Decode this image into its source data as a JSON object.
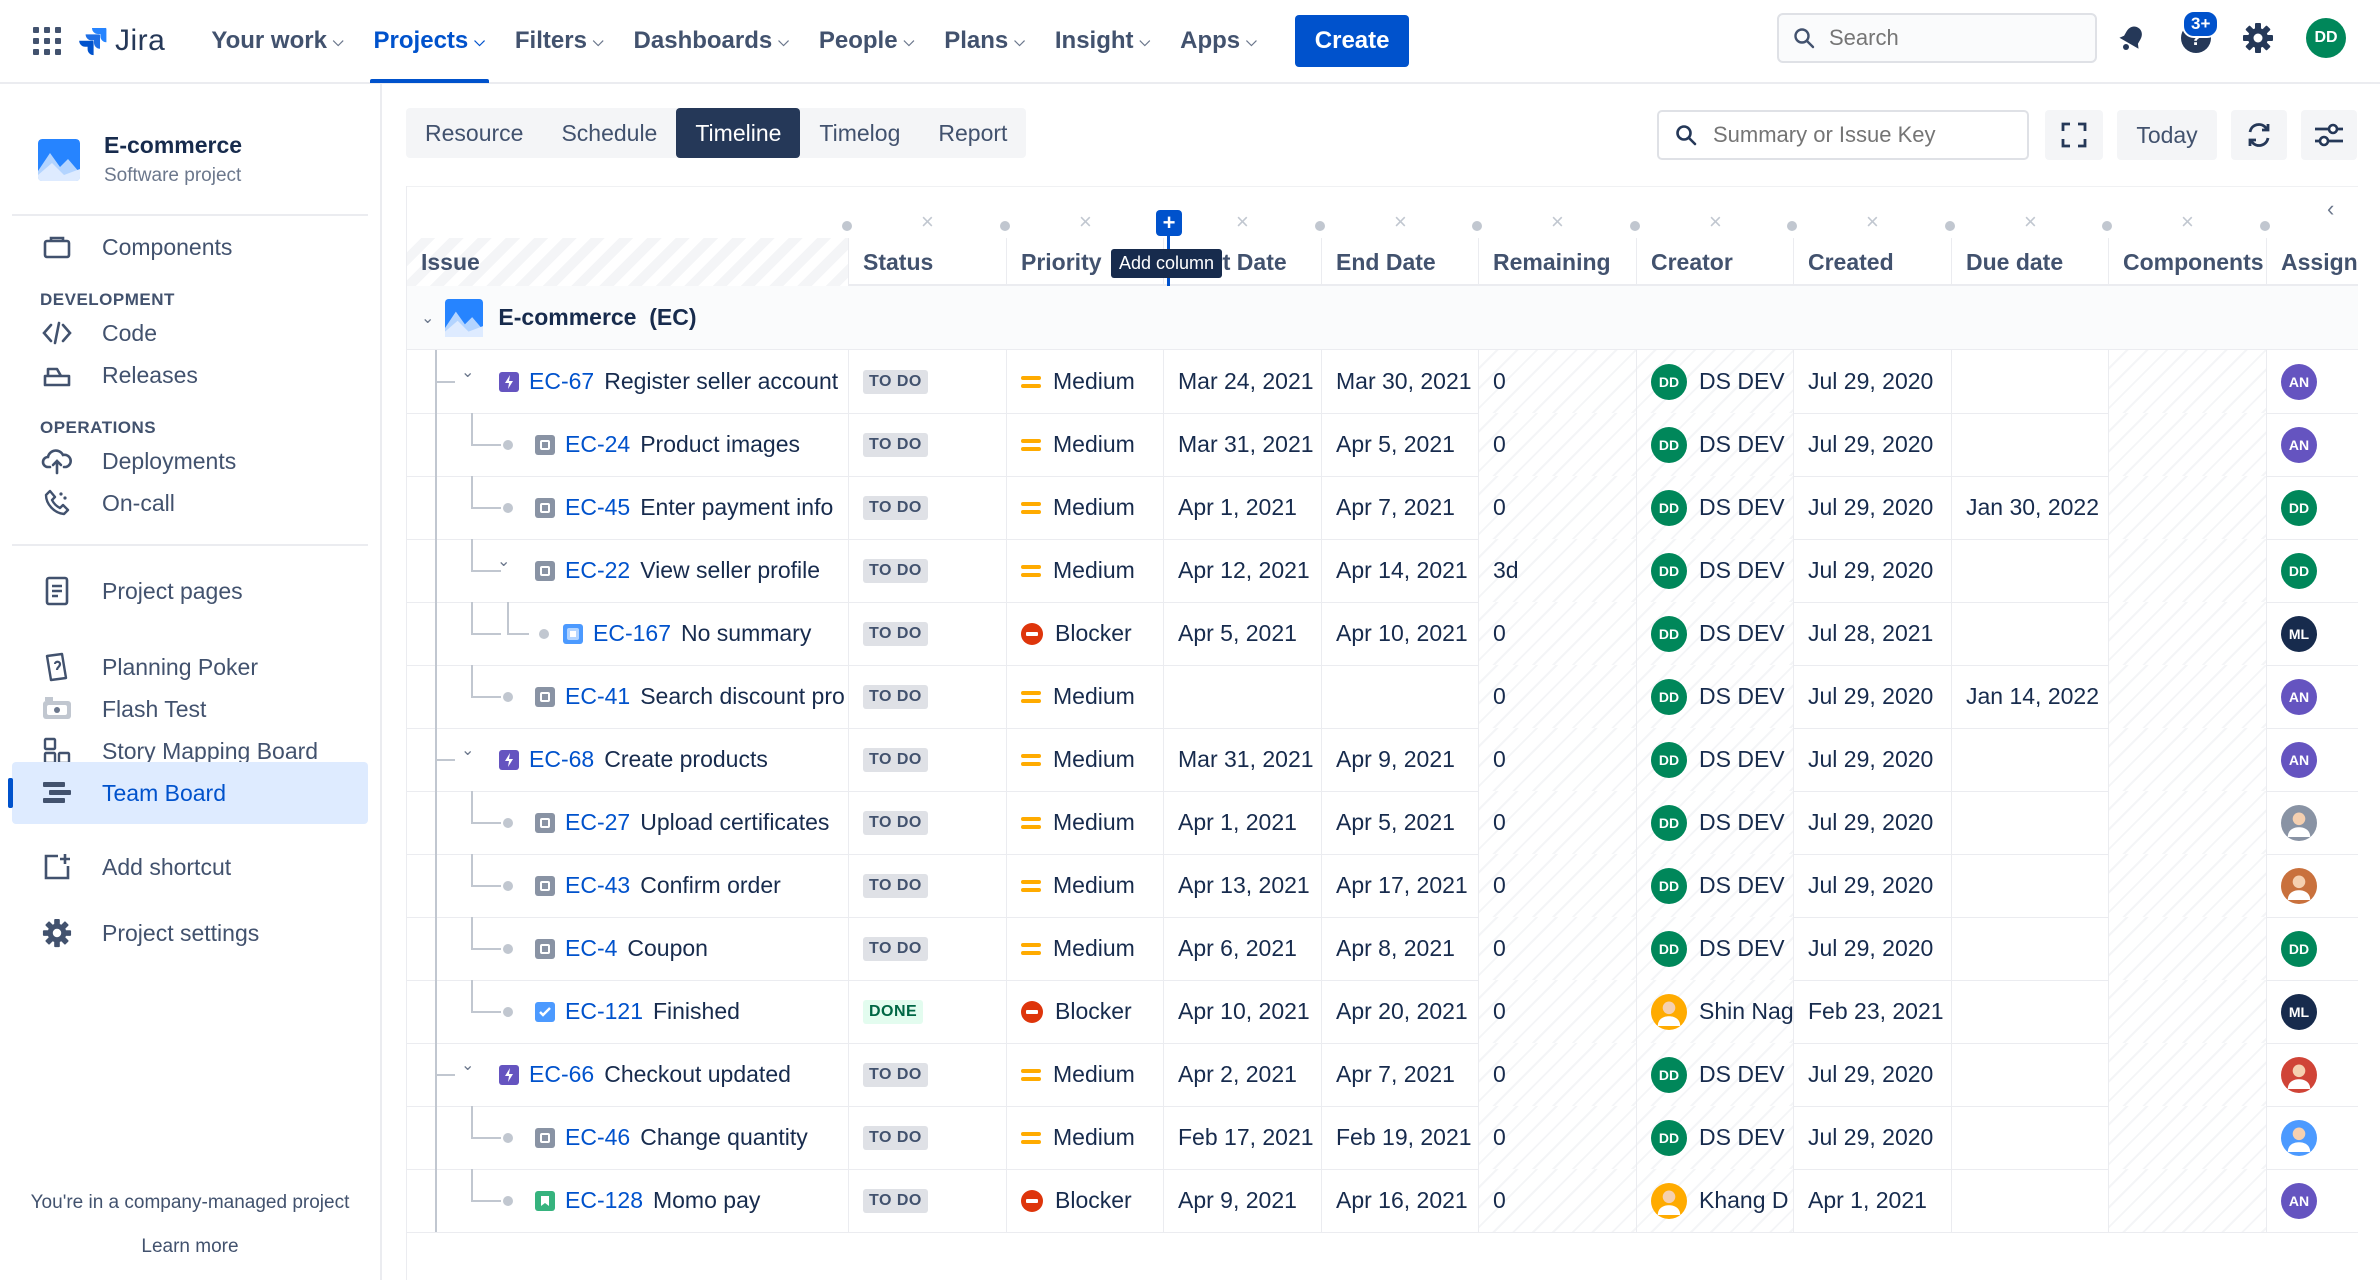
{
  "nav": {
    "logo": "Jira",
    "items": [
      {
        "label": "Your work",
        "active": false
      },
      {
        "label": "Projects",
        "active": true
      },
      {
        "label": "Filters",
        "active": false
      },
      {
        "label": "Dashboards",
        "active": false
      },
      {
        "label": "People",
        "active": false
      },
      {
        "label": "Plans",
        "active": false
      },
      {
        "label": "Insight",
        "active": false
      },
      {
        "label": "Apps",
        "active": false
      }
    ],
    "create_label": "Create",
    "search_placeholder": "Search",
    "notif_badge": "3+",
    "user_initials": "DD",
    "accent": "#0052cc"
  },
  "sidebar": {
    "project_name": "E-commerce",
    "project_type": "Software project",
    "items": {
      "components": "Components",
      "dev_section": "DEVELOPMENT",
      "code": "Code",
      "releases": "Releases",
      "ops_section": "OPERATIONS",
      "deployments": "Deployments",
      "oncall": "On-call",
      "project_pages": "Project pages",
      "planning_poker": "Planning Poker",
      "flash_test": "Flash Test",
      "story_mapping": "Story Mapping Board",
      "team_board": "Team Board",
      "add_shortcut": "Add shortcut",
      "project_settings": "Project settings"
    },
    "footer_text": "You're in a company-managed project",
    "learn_more": "Learn more"
  },
  "toolbar": {
    "tabs": [
      "Resource",
      "Schedule",
      "Timeline",
      "Timelog",
      "Report"
    ],
    "active_tab": "Timeline",
    "issue_search_placeholder": "Summary or Issue Key",
    "today_label": "Today"
  },
  "table": {
    "columns": [
      "Issue",
      "Status",
      "Priority",
      "Start Date",
      "End Date",
      "Remaining",
      "Creator",
      "Created",
      "Due date",
      "Components",
      "Assignee"
    ],
    "add_column_tooltip": "Add column",
    "group": {
      "name": "E-commerce",
      "key": "(EC)"
    },
    "rows": [
      {
        "key": "EC-67",
        "summary": "Register seller account",
        "type": "epic",
        "level": 0,
        "expand": true,
        "status": "TO DO",
        "priority": "Medium",
        "start": "Mar 24, 2021",
        "end": "Mar 30, 2021",
        "remaining": "0",
        "creator": "DS DEV",
        "creator_av": "DD",
        "created": "Jul 29, 2020",
        "due": "",
        "assignee": "AN",
        "assignee_color": "#6554c0"
      },
      {
        "key": "EC-24",
        "summary": "Product images",
        "type": "subtask",
        "level": 1,
        "expand": false,
        "status": "TO DO",
        "priority": "Medium",
        "start": "Mar 31, 2021",
        "end": "Apr 5, 2021",
        "remaining": "0",
        "creator": "DS DEV",
        "creator_av": "DD",
        "created": "Jul 29, 2020",
        "due": "",
        "assignee": "AN",
        "assignee_color": "#6554c0"
      },
      {
        "key": "EC-45",
        "summary": "Enter payment info",
        "type": "subtask",
        "level": 1,
        "expand": false,
        "status": "TO DO",
        "priority": "Medium",
        "start": "Apr 1, 2021",
        "end": "Apr 7, 2021",
        "remaining": "0",
        "creator": "DS DEV",
        "creator_av": "DD",
        "created": "Jul 29, 2020",
        "due": "Jan 30, 2022",
        "assignee": "DD",
        "assignee_color": "#00875a"
      },
      {
        "key": "EC-22",
        "summary": "View seller profile",
        "type": "subtask",
        "level": 1,
        "expand": true,
        "status": "TO DO",
        "priority": "Medium",
        "start": "Apr 12, 2021",
        "end": "Apr 14, 2021",
        "remaining": "3d",
        "creator": "DS DEV",
        "creator_av": "DD",
        "created": "Jul 29, 2020",
        "due": "",
        "assignee": "DD",
        "assignee_color": "#00875a"
      },
      {
        "key": "EC-167",
        "summary": "No summary",
        "type": "task",
        "level": 2,
        "expand": false,
        "status": "TO DO",
        "priority": "Blocker",
        "start": "Apr 5, 2021",
        "end": "Apr 10, 2021",
        "remaining": "0",
        "creator": "DS DEV",
        "creator_av": "DD",
        "created": "Jul 28, 2021",
        "due": "",
        "assignee": "ML",
        "assignee_color": "#172b4d"
      },
      {
        "key": "EC-41",
        "summary": "Search discount pro",
        "type": "subtask",
        "level": 1,
        "expand": false,
        "status": "TO DO",
        "priority": "Medium",
        "start": "",
        "end": "",
        "remaining": "0",
        "creator": "DS DEV",
        "creator_av": "DD",
        "created": "Jul 29, 2020",
        "due": "Jan 14, 2022",
        "assignee": "AN",
        "assignee_color": "#6554c0"
      },
      {
        "key": "EC-68",
        "summary": "Create products",
        "type": "epic",
        "level": 0,
        "expand": true,
        "status": "TO DO",
        "priority": "Medium",
        "start": "Mar 31, 2021",
        "end": "Apr 9, 2021",
        "remaining": "0",
        "creator": "DS DEV",
        "creator_av": "DD",
        "created": "Jul 29, 2020",
        "due": "",
        "assignee": "AN",
        "assignee_color": "#6554c0"
      },
      {
        "key": "EC-27",
        "summary": "Upload certificates",
        "type": "subtask",
        "level": 1,
        "expand": false,
        "status": "TO DO",
        "priority": "Medium",
        "start": "Apr 1, 2021",
        "end": "Apr 5, 2021",
        "remaining": "0",
        "creator": "DS DEV",
        "creator_av": "DD",
        "created": "Jul 29, 2020",
        "due": "",
        "assignee": "",
        "assignee_color": "#8993a4"
      },
      {
        "key": "EC-43",
        "summary": "Confirm order",
        "type": "subtask",
        "level": 1,
        "expand": false,
        "status": "TO DO",
        "priority": "Medium",
        "start": "Apr 13, 2021",
        "end": "Apr 17, 2021",
        "remaining": "0",
        "creator": "DS DEV",
        "creator_av": "DD",
        "created": "Jul 29, 2020",
        "due": "",
        "assignee": "",
        "assignee_color": "#c9713d"
      },
      {
        "key": "EC-4",
        "summary": "Coupon",
        "type": "subtask",
        "level": 1,
        "expand": false,
        "status": "TO DO",
        "priority": "Medium",
        "start": "Apr 6, 2021",
        "end": "Apr 8, 2021",
        "remaining": "0",
        "creator": "DS DEV",
        "creator_av": "DD",
        "created": "Jul 29, 2020",
        "due": "",
        "assignee": "DD",
        "assignee_color": "#00875a"
      },
      {
        "key": "EC-121",
        "summary": "Finished",
        "type": "task-done",
        "level": 1,
        "expand": false,
        "status": "DONE",
        "priority": "Blocker",
        "start": "Apr 10, 2021",
        "end": "Apr 20, 2021",
        "remaining": "0",
        "creator": "Shin Nag",
        "creator_av": "",
        "created": "Feb 23, 2021",
        "due": "",
        "assignee": "ML",
        "assignee_color": "#172b4d"
      },
      {
        "key": "EC-66",
        "summary": "Checkout updated",
        "type": "epic",
        "level": 0,
        "expand": true,
        "status": "TO DO",
        "priority": "Medium",
        "start": "Apr 2, 2021",
        "end": "Apr 7, 2021",
        "remaining": "0",
        "creator": "DS DEV",
        "creator_av": "DD",
        "created": "Jul 29, 2020",
        "due": "",
        "assignee": "",
        "assignee_color": "#d04437"
      },
      {
        "key": "EC-46",
        "summary": "Change quantity",
        "type": "subtask",
        "level": 1,
        "expand": false,
        "status": "TO DO",
        "priority": "Medium",
        "start": "Feb 17, 2021",
        "end": "Feb 19, 2021",
        "remaining": "0",
        "creator": "DS DEV",
        "creator_av": "DD",
        "created": "Jul 29, 2020",
        "due": "",
        "assignee": "",
        "assignee_color": "#4c9aff"
      },
      {
        "key": "EC-128",
        "summary": "Momo pay",
        "type": "story",
        "level": 1,
        "expand": false,
        "status": "TO DO",
        "priority": "Blocker",
        "start": "Apr 9, 2021",
        "end": "Apr 16, 2021",
        "remaining": "0",
        "creator": "Khang D",
        "creator_av": "",
        "created": "Apr 1, 2021",
        "due": "",
        "assignee": "AN",
        "assignee_color": "#6554c0"
      }
    ]
  }
}
